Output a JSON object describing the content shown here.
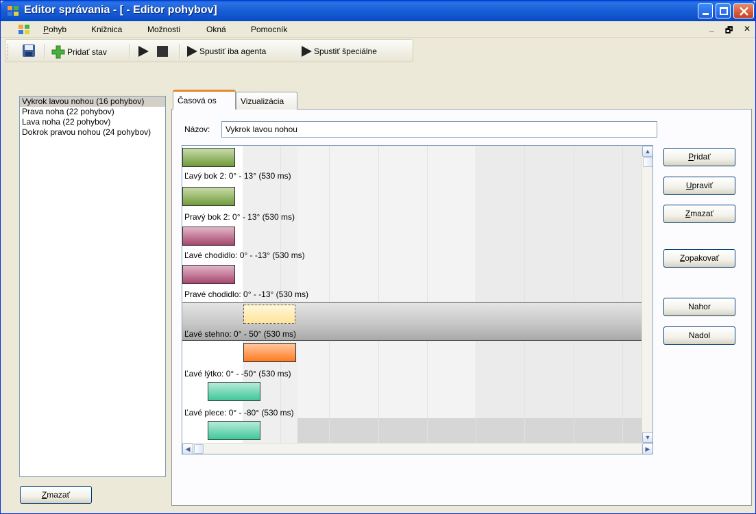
{
  "window": {
    "title": "Editor správania - [ - Editor pohybov]"
  },
  "menu": [
    {
      "label": "Pohyb",
      "accel": "P",
      "rest": "ohyb"
    },
    {
      "label": "Knižnica"
    },
    {
      "label": "Možnosti"
    },
    {
      "label": "Okná"
    },
    {
      "label": "Pomocník"
    }
  ],
  "mdi_controls": {
    "minimize": "_",
    "restore": "🗗",
    "close": "✕"
  },
  "toolbar": {
    "add_state": "Pridať stav",
    "run_agent": "Spustiť iba agenta",
    "run_special": "Spustiť špeciálne"
  },
  "motions": [
    {
      "label": "Vykrok lavou nohou (16 pohybov)",
      "selected": true
    },
    {
      "label": "Prava noha (22 pohybov)"
    },
    {
      "label": "Lava noha (22 pohybov)"
    },
    {
      "label": "Dokrok pravou nohou (24 pohybov)"
    }
  ],
  "left_delete": {
    "accel": "Z",
    "rest": "mazať"
  },
  "tabs": [
    {
      "label": "Časová os",
      "active": true
    },
    {
      "label": "Vizualizácia"
    }
  ],
  "name_label": "Názov:",
  "name_value": "Vykrok lavou nohou",
  "tracks": [
    {
      "label": "Ľavý bok 2: 0° - 13° (530 ms)",
      "color": "#6f9a3a"
    },
    {
      "label": "Pravý bok 2: 0° - 13° (530 ms)",
      "color": "#6f9a3a"
    },
    {
      "label": "Ľavé chodidlo: 0° - -13° (530 ms)",
      "color": "#a8466e"
    },
    {
      "label": "Pravé chodidlo: 0° - -13° (530 ms)",
      "color": "#a8466e"
    },
    {
      "label": "Ľavé stehno: 0° - 50° (530 ms)",
      "color": "#ffe8a0",
      "selected": true
    },
    {
      "label": "Ľavé lýtko: 0° - -50° (530 ms)",
      "color": "#ff8a3a"
    },
    {
      "label": "Ľavé plece: 0° - -80° (530 ms)",
      "color": "#3ec79a"
    },
    {
      "label": "",
      "color": "#3ec79a"
    }
  ],
  "actions": {
    "add": {
      "accel": "P",
      "rest": "ridať"
    },
    "edit": {
      "accel": "U",
      "rest": "praviť"
    },
    "delete": {
      "accel": "Z",
      "rest": "mazať"
    },
    "repeat": {
      "accel": "Z",
      "rest": "opakovať"
    },
    "up": "Nahor",
    "down": "Nadol"
  },
  "colors": {
    "title_blue": "#0b4fcc",
    "panel_bg": "#ece9d8",
    "selected_tab_accent": "#e68b2c"
  }
}
